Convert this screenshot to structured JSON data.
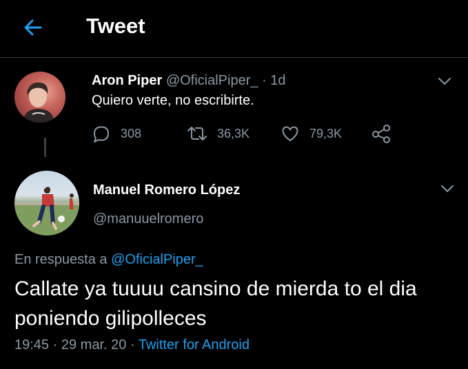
{
  "header": {
    "title": "Tweet"
  },
  "parent_tweet": {
    "author_name": "Aron Piper",
    "handle": "@OficialPiper_",
    "separator": "·",
    "time": "1d",
    "text": "Quiero verte, no escribirte.",
    "replies": "308",
    "retweets": "36,3K",
    "likes": "79,3K"
  },
  "reply_tweet": {
    "author_name": "Manuel Romero López",
    "handle": "@manuuelromero",
    "replying_prefix": "En respuesta a",
    "replying_to": "@OficialPiper_",
    "text": "Callate ya tuuuu cansino de mierda to el dia poniendo gilipolleces",
    "time": "19:45",
    "separator1": "·",
    "date": "29 mar. 20",
    "separator2": "·",
    "source": "Twitter for Android"
  },
  "colors": {
    "background": "#000000",
    "accent": "#1da1f2",
    "secondary_text": "#8b98a5",
    "divider": "#2f3336"
  },
  "icons": {
    "back": "arrow-left-icon",
    "reply": "speech-bubble-icon",
    "retweet": "retweet-icon",
    "like": "heart-icon",
    "share": "share-nodes-icon",
    "more": "chevron-down-icon"
  }
}
